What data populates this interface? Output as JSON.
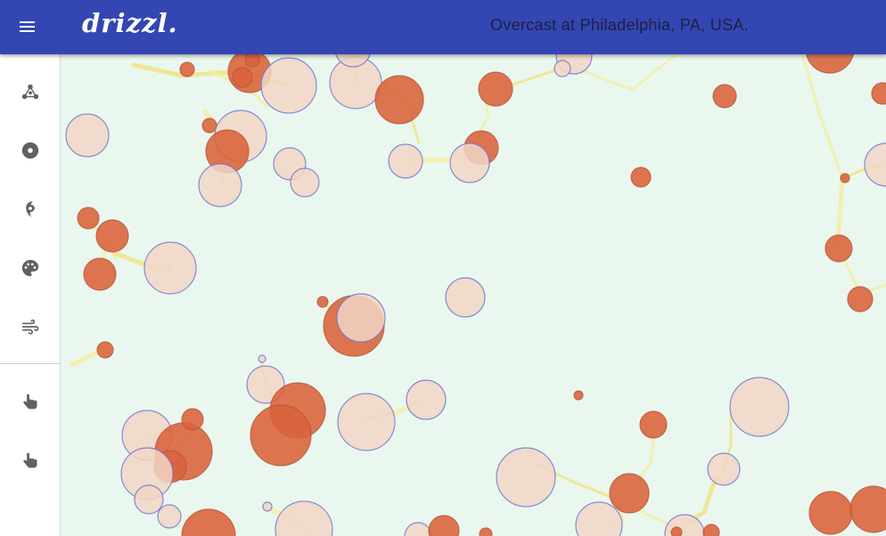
{
  "app": {
    "logo_text": "drizzl."
  },
  "header": {
    "status_text": "Overcast at Philadelphia, PA, USA."
  },
  "icons": {
    "menu": "menu-icon",
    "sidebar": [
      "cluster-icon",
      "disc-icon",
      "hurricane-icon",
      "palette-icon",
      "wind-icon",
      "pointer-hand-icon",
      "pointer-hand-icon"
    ]
  },
  "colors": {
    "appbar": "#3446b2",
    "map_background": "#eaf7ef",
    "bubble_light_fill": "#f1d6c6",
    "bubble_dark_fill": "#d9623a",
    "bubble_stroke": "#6f6fd0",
    "link_line": "#f4ed9a"
  }
}
